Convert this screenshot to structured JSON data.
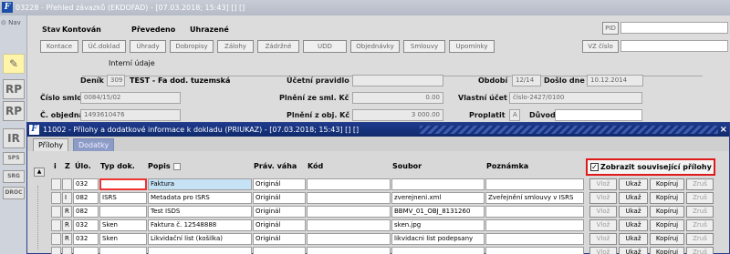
{
  "bg_window": {
    "title": "03228 - Přehled závazků (EKDOFAD) - [07.03.2018; 15:43] [] []",
    "nav_label": "Nav",
    "status": {
      "stav_label": "Stav",
      "stav": "Kontován",
      "prevedeno": "Převedeno",
      "uhrazene": "Uhrazené"
    },
    "buttons": [
      "Kontace",
      "Úč.doklad",
      "Úhrady",
      "Dobropisy",
      "Zálohy",
      "Zádržné",
      "UDD",
      "Objednávky",
      "Smlouvy",
      "Upomínky"
    ],
    "pid_label": "PID",
    "vz_label": "VZ číslo",
    "group_label": "Interní údaje",
    "deník_label": "Deník",
    "denik_value": "309",
    "denik_text": "TEST - Fa dod. tuzemská",
    "ucetni_pravidlo_label": "Účetní pravidlo",
    "obdobi_label": "Období",
    "obdobi_value": "12/14",
    "doslo_label": "Došlo dne",
    "doslo_value": "10.12.2014",
    "cislo_smlouvy_label": "Číslo smlouvy",
    "cislo_smlouvy_value": "0084/15/02",
    "plneni_sml_label": "Plnění ze sml. Kč",
    "plneni_sml_value": "0.00",
    "vlastni_ucet_label": "Vlastní účet",
    "vlastni_ucet_value": "číslo-2427/0100",
    "c_objednavky_label": "Č. objednávky",
    "c_objednavky_value": "1493610476",
    "plneni_obj_label": "Plnění z obj. Kč",
    "plneni_obj_value": "3 000.00",
    "proplatit_label": "Proplatit",
    "proplatit_value": "A",
    "duvod_label": "Důvod",
    "side_tools": [
      "RP",
      "RP",
      "IR",
      "SPS",
      "SRG",
      "DROC"
    ]
  },
  "dialog": {
    "title": "11002 - Přílohy a dodatkové informace k dokladu (PRIUKAZ) - [07.03.2018; 15:43] [] []",
    "close_glyph": "×",
    "tabs": [
      "Přílohy",
      "Dodatky"
    ],
    "columns": {
      "i": "i",
      "z": "Z",
      "ulo": "Úlo.",
      "typ": "Typ dok.",
      "popis": "Popis",
      "prav": "Práv. váha",
      "kod": "Kód",
      "soubor": "Soubor",
      "poznamka": "Poznámka"
    },
    "show_related": {
      "label": "Zobrazit související přílohy",
      "checked": true
    },
    "row_buttons": {
      "vloz": "Vlož",
      "ukaz": "Ukaž",
      "kopiruj": "Kopíruj",
      "zrus": "Zruš"
    },
    "rows": [
      {
        "i": "",
        "z": "",
        "ulo": "032",
        "typ": "",
        "popis": "Faktura",
        "prav": "Originál",
        "kod": "",
        "soubor": "",
        "poznamka": ""
      },
      {
        "i": "",
        "z": "I",
        "ulo": "082",
        "typ": "ISRS",
        "popis": "Metadata pro ISRS",
        "prav": "Originál",
        "kod": "",
        "soubor": "zverejneni.xml",
        "poznamka": "Zveřejnění smlouvy v ISRS"
      },
      {
        "i": "",
        "z": "R",
        "ulo": "082",
        "typ": "",
        "popis": "Test ISDS",
        "prav": "Originál",
        "kod": "",
        "soubor": "BBMV_01_OBJ_8131260",
        "poznamka": ""
      },
      {
        "i": "",
        "z": "R",
        "ulo": "032",
        "typ": "Sken",
        "popis": "Faktura č. 12548888",
        "prav": "Originál",
        "kod": "",
        "soubor": "sken.jpg",
        "poznamka": ""
      },
      {
        "i": "",
        "z": "R",
        "ulo": "032",
        "typ": "Sken",
        "popis": "Likvidační list (košilka)",
        "prav": "Originál",
        "kod": "",
        "soubor": "likvidacni list podepsany",
        "poznamka": ""
      },
      {
        "i": "",
        "z": "",
        "ulo": "",
        "typ": "",
        "popis": "",
        "prav": "",
        "kod": "",
        "soubor": "",
        "poznamka": ""
      }
    ]
  }
}
